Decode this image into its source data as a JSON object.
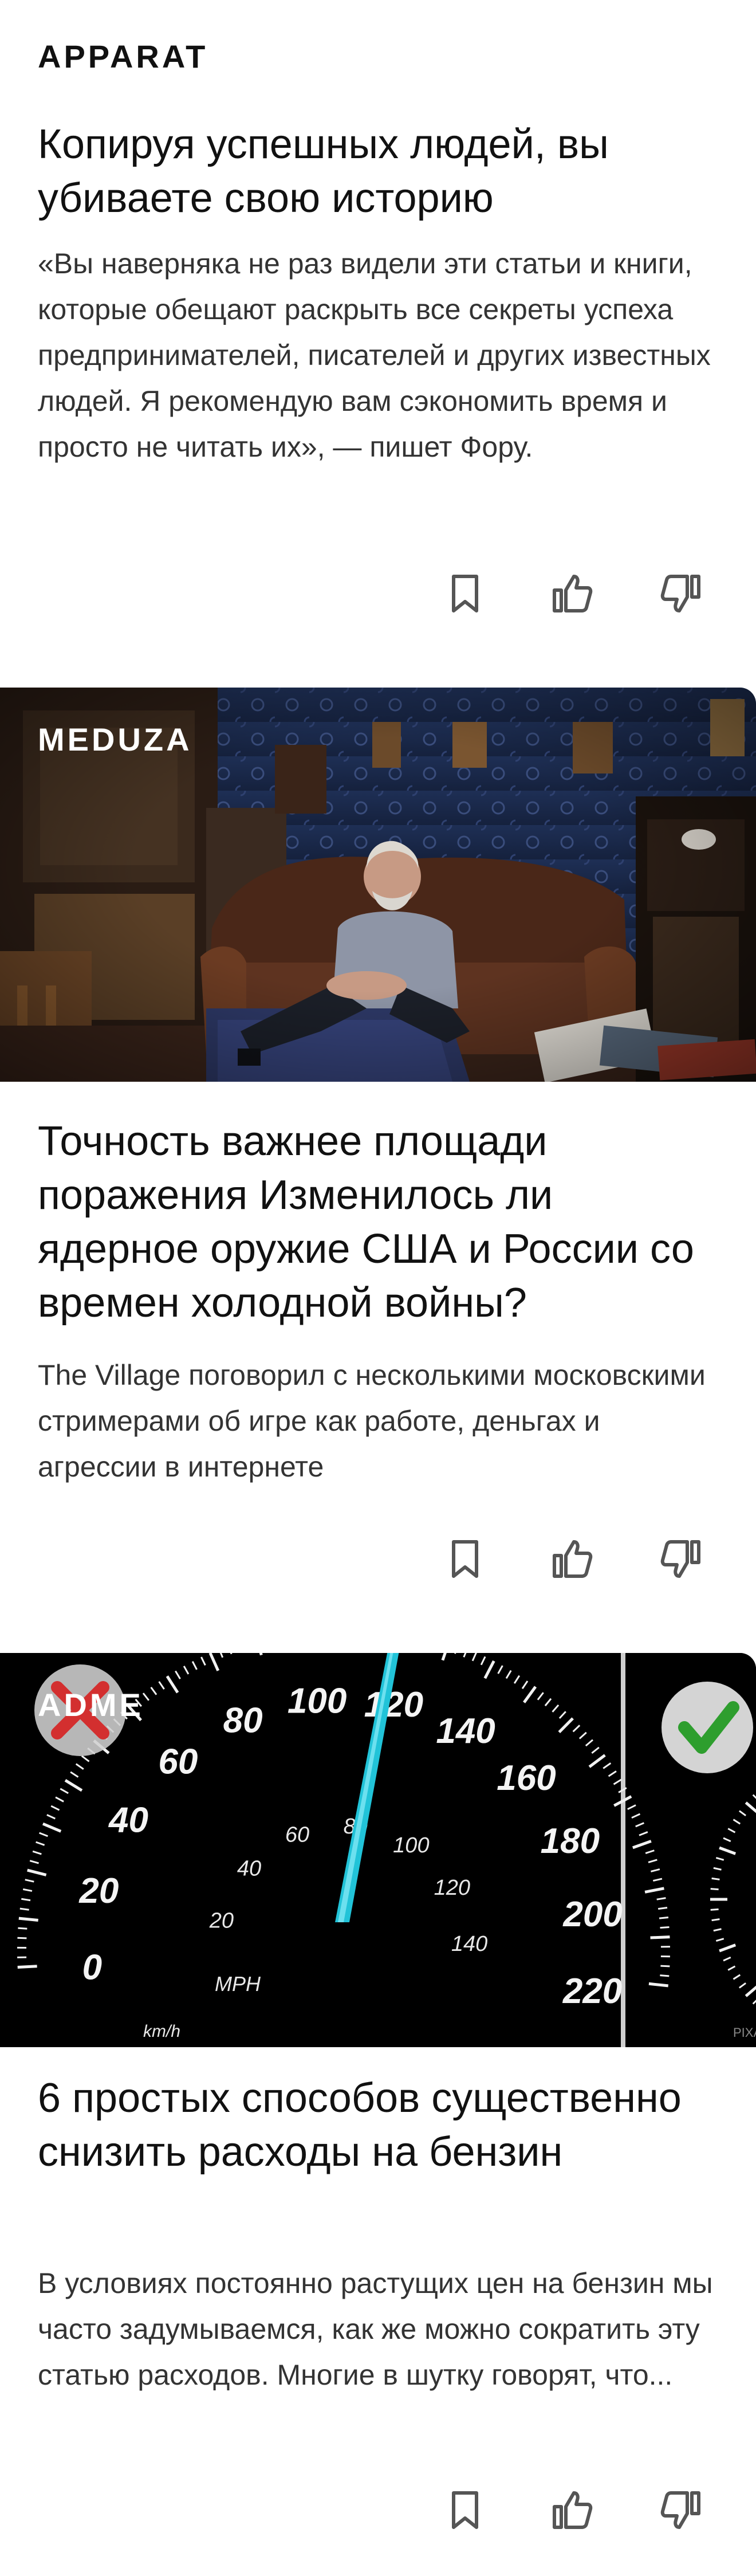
{
  "cards": [
    {
      "source": "APPARAT",
      "title": "Копируя успешных людей, вы убиваете свою историю",
      "snippet": "«Вы наверняка не раз видели эти статьи и книги, которые обещают раскрыть все секреты успеха предпринимателей, писателей и других известных людей. Я рекомендую вам сэкономить время и просто не читать их», — пишет Фору.",
      "actions": [
        "bookmark-icon",
        "like-icon",
        "dislike-icon"
      ]
    },
    {
      "source": "MEDUZA",
      "title": "Точность важнее площади поражения Изменилось ли ядерное оружие США и России со времен холодной войны?",
      "snippet": "The Village поговорил с несколькими московскими стримерами об игре как работе, деньгах и агрессии в интернете",
      "actions": [
        "bookmark-icon",
        "like-icon",
        "dislike-icon"
      ]
    },
    {
      "source": "ADME",
      "title": "6 простых способов существенно снизить расходы на бензин",
      "snippet": "В условиях постоянно растущих цен на бензин мы часто задумываемся, как же можно сократить эту статью расходов. Многие в шутку говорят, что...",
      "actions": [
        "bookmark-icon",
        "like-icon",
        "dislike-icon"
      ],
      "speedometer": {
        "major_labels": [
          "0",
          "20",
          "40",
          "60",
          "80",
          "100",
          "120",
          "140",
          "160",
          "180",
          "200",
          "220"
        ],
        "minor_labels": [
          "20",
          "40",
          "60",
          "80",
          "100",
          "120",
          "140"
        ],
        "unit_big": "km/h",
        "unit_small": "MPH",
        "watermark": "PIXA"
      }
    }
  ],
  "colors": {
    "text": "#111111",
    "snippet": "#333333",
    "icon": "#555555",
    "needle": "#21c3d8",
    "bad": "#d32f2f",
    "good": "#2e9e2e"
  }
}
